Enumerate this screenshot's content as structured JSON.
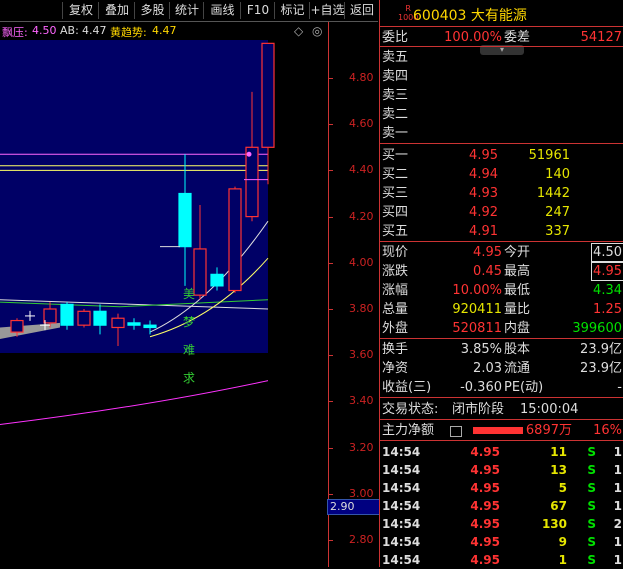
{
  "toolbar": {
    "buttons": [
      "复权",
      "叠加",
      "多股",
      "统计",
      "画线",
      "F10",
      "标记",
      "+自选",
      "返回"
    ]
  },
  "info": {
    "piao_label": "飘压:",
    "piao_value": "4.50",
    "ab_label": "AB:",
    "ab_value": "4.47",
    "trend_label": "黄趋势:",
    "trend_value": "4.47"
  },
  "chart_data": {
    "type": "candlestick",
    "y_axis_ticks": [
      "4.80",
      "4.60",
      "4.40",
      "4.20",
      "4.00",
      "3.80",
      "3.60",
      "3.40",
      "3.20",
      "3.00",
      "2.80"
    ],
    "current_price_tag": "2.90",
    "annotations": [
      "美",
      "梦",
      "难",
      "求"
    ],
    "candles": [
      {
        "open": 3.7,
        "close": 3.75,
        "high": 3.76,
        "low": 3.68,
        "color": "red"
      },
      {
        "open": 3.74,
        "close": 3.8,
        "high": 3.83,
        "low": 3.72,
        "color": "red"
      },
      {
        "open": 3.82,
        "close": 3.73,
        "high": 3.83,
        "low": 3.71,
        "color": "cyan"
      },
      {
        "open": 3.73,
        "close": 3.79,
        "high": 3.8,
        "low": 3.72,
        "color": "red"
      },
      {
        "open": 3.79,
        "close": 3.73,
        "high": 3.82,
        "low": 3.69,
        "color": "cyan"
      },
      {
        "open": 3.72,
        "close": 3.76,
        "high": 3.78,
        "low": 3.64,
        "color": "red"
      },
      {
        "open": 3.74,
        "close": 3.73,
        "high": 3.76,
        "low": 3.71,
        "color": "cyan"
      },
      {
        "open": 3.72,
        "close": 3.73,
        "high": 3.75,
        "low": 3.69,
        "color": "cyan"
      },
      {
        "open": 4.07,
        "close": 4.3,
        "high": 4.47,
        "low": 3.9,
        "color": "cyan"
      },
      {
        "open": 3.86,
        "close": 4.06,
        "high": 4.25,
        "low": 3.84,
        "color": "red"
      },
      {
        "open": 3.95,
        "close": 3.9,
        "high": 3.98,
        "low": 3.88,
        "color": "cyan"
      },
      {
        "open": 3.88,
        "close": 4.32,
        "high": 4.33,
        "low": 3.87,
        "color": "red"
      },
      {
        "open": 4.2,
        "close": 4.5,
        "high": 4.74,
        "low": 4.18,
        "color": "red"
      },
      {
        "open": 4.5,
        "close": 4.95,
        "high": 4.95,
        "low": 4.34,
        "color": "red"
      }
    ]
  },
  "quote": {
    "badge_top": "R",
    "badge_bottom": "1000",
    "title": "600403 大有能源",
    "weibi_label": "委比",
    "weibi_value": "100.00%",
    "weicha_label": "委差",
    "weicha_value": "54127",
    "asks": [
      {
        "label": "卖五"
      },
      {
        "label": "卖四"
      },
      {
        "label": "卖三"
      },
      {
        "label": "卖二"
      },
      {
        "label": "卖一"
      }
    ],
    "bids": [
      {
        "label": "买一",
        "price": "4.95",
        "vol": "51961"
      },
      {
        "label": "买二",
        "price": "4.94",
        "vol": "140"
      },
      {
        "label": "买三",
        "price": "4.93",
        "vol": "1442"
      },
      {
        "label": "买四",
        "price": "4.92",
        "vol": "247"
      },
      {
        "label": "买五",
        "price": "4.91",
        "vol": "337"
      }
    ],
    "stats": [
      {
        "l1": "现价",
        "v1": "4.95",
        "l2": "今开",
        "v2": "4.50"
      },
      {
        "l1": "涨跌",
        "v1": "0.45",
        "l2": "最高",
        "v2": "4.95"
      },
      {
        "l1": "涨幅",
        "v1": "10.00%",
        "l2": "最低",
        "v2": "4.34"
      },
      {
        "l1": "总量",
        "v1": "920411",
        "l2": "量比",
        "v2": "1.25"
      },
      {
        "l1": "外盘",
        "v1": "520811",
        "l2": "内盘",
        "v2": "399600"
      }
    ],
    "stats2": [
      {
        "l1": "换手",
        "v1": "3.85%",
        "l2": "股本",
        "v2": "23.9亿"
      },
      {
        "l1": "净资",
        "v1": "2.03",
        "l2": "流通",
        "v2": "23.9亿"
      },
      {
        "l1": "收益(三)",
        "v1": "-0.360",
        "l2": "PE(动)",
        "v2": "-"
      }
    ],
    "trade_status_label": "交易状态:",
    "trade_status": "闭市阶段",
    "trade_time": "15:00:04",
    "main_flow_label": "主力净额",
    "main_flow_value": "6897万",
    "main_flow_pct": "16%",
    "ticks": [
      {
        "t": "14:54",
        "p": "4.95",
        "v": "11",
        "d": "S",
        "n": "1"
      },
      {
        "t": "14:54",
        "p": "4.95",
        "v": "13",
        "d": "S",
        "n": "1"
      },
      {
        "t": "14:54",
        "p": "4.95",
        "v": "5",
        "d": "S",
        "n": "1"
      },
      {
        "t": "14:54",
        "p": "4.95",
        "v": "67",
        "d": "S",
        "n": "1"
      },
      {
        "t": "14:54",
        "p": "4.95",
        "v": "130",
        "d": "S",
        "n": "2"
      },
      {
        "t": "14:54",
        "p": "4.95",
        "v": "9",
        "d": "S",
        "n": "1"
      },
      {
        "t": "14:54",
        "p": "4.95",
        "v": "1",
        "d": "S",
        "n": "1"
      }
    ]
  },
  "colors": {
    "up": "#ff3333",
    "down": "#00ffff",
    "bg_chart": "#000066",
    "accent": "#ffd700"
  }
}
